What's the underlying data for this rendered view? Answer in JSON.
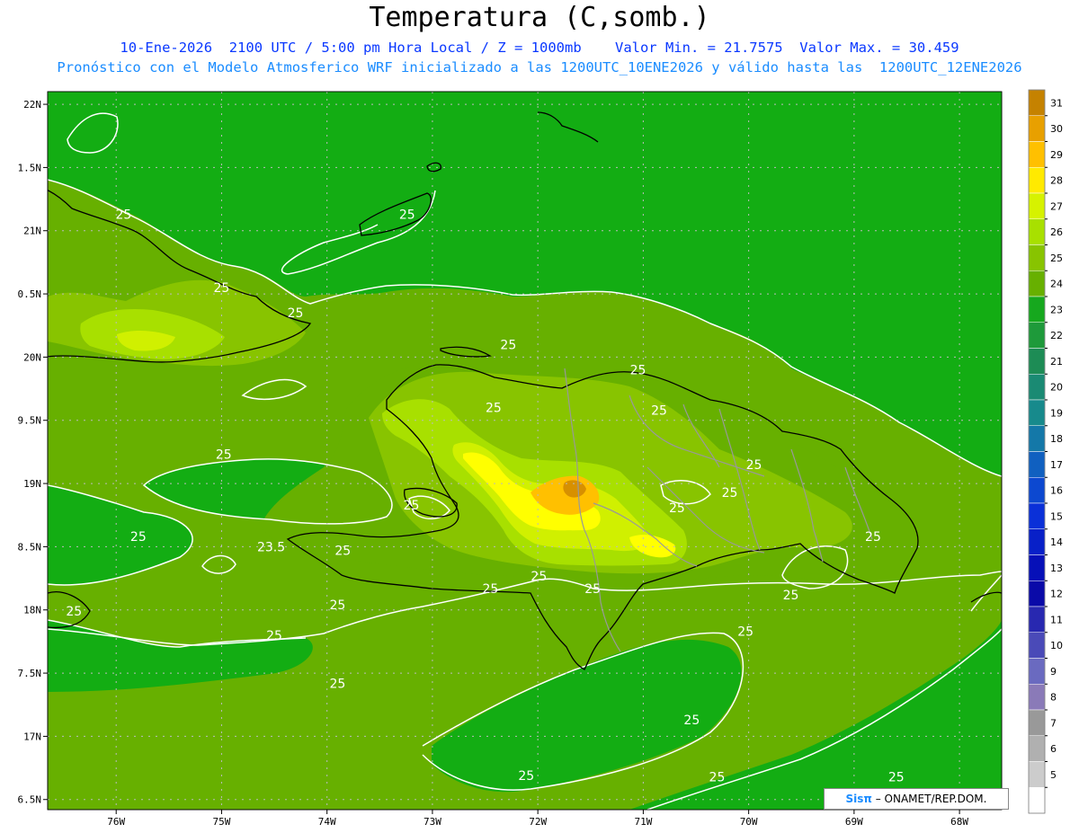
{
  "header": {
    "title": "Temperatura (C,somb.)",
    "subtitle_1": "10-Ene-2026  2100 UTC / 5:00 pm Hora Local / Z = 1000mb    Valor Min. = 21.7575  Valor Max. = 30.459",
    "subtitle_2": "Pronóstico con el Modelo Atmosferico WRF inicializado a las 1200UTC_10ENE2026 y válido hasta las  1200UTC_12ENE2026"
  },
  "axes": {
    "lat_labels": [
      "22N",
      "1.5N",
      "21N",
      "0.5N",
      "20N",
      "9.5N",
      "19N",
      "8.5N",
      "18N",
      "7.5N",
      "17N",
      "6.5N"
    ],
    "lat_values": [
      22,
      21.5,
      21,
      20.5,
      20,
      19.5,
      19,
      18.5,
      18,
      17.5,
      17,
      16.5
    ],
    "lon_labels": [
      "76W",
      "75W",
      "74W",
      "73W",
      "72W",
      "71W",
      "70W",
      "69W",
      "68W"
    ],
    "lon_values": [
      -76,
      -75,
      -74,
      -73,
      -72,
      -71,
      -70,
      -69,
      -68
    ],
    "lat_range": [
      16.42,
      22.1
    ],
    "lon_range": [
      -76.65,
      -67.6
    ]
  },
  "colors": {
    "background_25": "#67b000",
    "t24": "#13ad13",
    "t23": "#1f9c36",
    "t26": "#88c400",
    "t27": "#a8e000",
    "t28": "#d0f000",
    "t29": "#ffff00",
    "t30": "#ffc000",
    "t31": "#d79000",
    "contour": "#ffffff",
    "coast": "#000000",
    "border": "#999999"
  },
  "legend": {
    "labels": [
      "31",
      "30",
      "29",
      "28",
      "27",
      "26",
      "25",
      "24",
      "23",
      "22",
      "21",
      "20",
      "19",
      "18",
      "17",
      "16",
      "15",
      "14",
      "13",
      "12",
      "11",
      "10",
      "9",
      "8",
      "7",
      "6",
      "5"
    ],
    "colors": [
      "#c58200",
      "#e8a000",
      "#ffc000",
      "#ffea00",
      "#d6f200",
      "#a8e000",
      "#88c400",
      "#67b000",
      "#16a81e",
      "#1e9a3a",
      "#1d8c55",
      "#1a8a73",
      "#178a8c",
      "#1478a8",
      "#1060c0",
      "#0c48d0",
      "#0a30d8",
      "#0820c8",
      "#0610b8",
      "#0a0aa8",
      "#2828b0",
      "#4a4ab8",
      "#6a6ac0",
      "#8a7ab8",
      "#999999",
      "#b0b0b0",
      "#cccccc",
      "#ffffff"
    ]
  },
  "contour_labels": [
    {
      "text": "25",
      "lon": -75.93,
      "lat": 21.13
    },
    {
      "text": "25",
      "lon": -73.24,
      "lat": 21.13
    },
    {
      "text": "25",
      "lon": -75.0,
      "lat": 20.55
    },
    {
      "text": "25",
      "lon": -74.3,
      "lat": 20.35
    },
    {
      "text": "25",
      "lon": -72.28,
      "lat": 20.1
    },
    {
      "text": "25",
      "lon": -71.05,
      "lat": 19.9
    },
    {
      "text": "25",
      "lon": -72.42,
      "lat": 19.6
    },
    {
      "text": "25",
      "lon": -70.85,
      "lat": 19.58
    },
    {
      "text": "25",
      "lon": -74.98,
      "lat": 19.23
    },
    {
      "text": "25",
      "lon": -69.95,
      "lat": 19.15
    },
    {
      "text": "25",
      "lon": -70.18,
      "lat": 18.93
    },
    {
      "text": "25",
      "lon": -73.2,
      "lat": 18.83
    },
    {
      "text": "25",
      "lon": -70.68,
      "lat": 18.81
    },
    {
      "text": "25",
      "lon": -75.79,
      "lat": 18.58
    },
    {
      "text": "23.5",
      "lon": -74.53,
      "lat": 18.5
    },
    {
      "text": "25",
      "lon": -73.85,
      "lat": 18.47
    },
    {
      "text": "25",
      "lon": -68.82,
      "lat": 18.58
    },
    {
      "text": "25",
      "lon": -71.99,
      "lat": 18.27
    },
    {
      "text": "25",
      "lon": -72.45,
      "lat": 18.17
    },
    {
      "text": "25",
      "lon": -71.48,
      "lat": 18.17
    },
    {
      "text": "25",
      "lon": -69.6,
      "lat": 18.12
    },
    {
      "text": "25",
      "lon": -73.9,
      "lat": 18.04
    },
    {
      "text": "25",
      "lon": -76.4,
      "lat": 17.99
    },
    {
      "text": "25",
      "lon": -74.5,
      "lat": 17.8
    },
    {
      "text": "25",
      "lon": -70.03,
      "lat": 17.83
    },
    {
      "text": "25",
      "lon": -73.9,
      "lat": 17.42
    },
    {
      "text": "25",
      "lon": -70.54,
      "lat": 17.13
    },
    {
      "text": "25",
      "lon": -72.11,
      "lat": 16.69
    },
    {
      "text": "25",
      "lon": -70.3,
      "lat": 16.68
    },
    {
      "text": "25",
      "lon": -68.6,
      "lat": 16.68
    }
  ],
  "credit": {
    "brand": "Sisπ",
    "text": " – ONAMET/REP.DOM."
  }
}
